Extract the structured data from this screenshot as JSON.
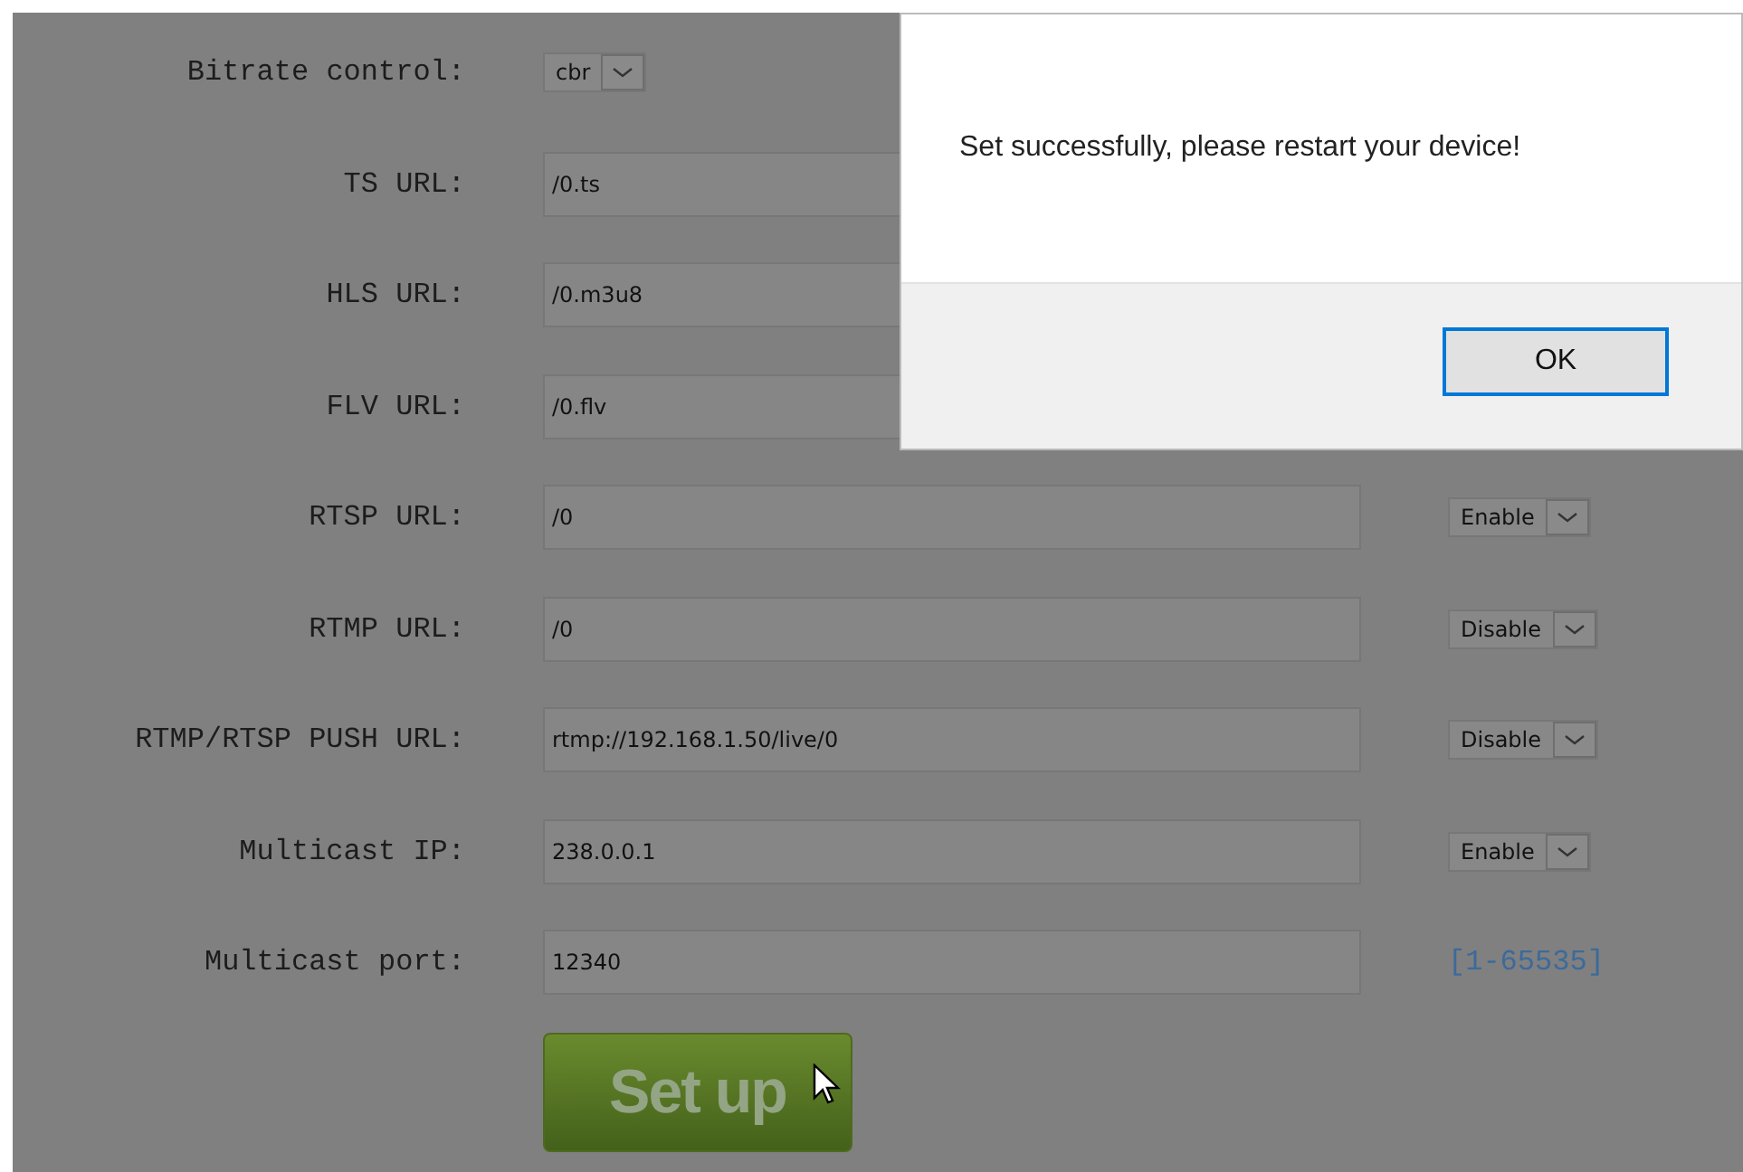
{
  "form": {
    "rows": [
      {
        "kind": "select",
        "label": "Bitrate control:",
        "value": "cbr"
      },
      {
        "kind": "input",
        "label": "TS URL:",
        "value": "/0.ts"
      },
      {
        "kind": "input",
        "label": "HLS URL:",
        "value": "/0.m3u8"
      },
      {
        "kind": "input",
        "label": "FLV URL:",
        "value": "/0.flv"
      },
      {
        "kind": "input",
        "label": "RTSP URL:",
        "value": "/0",
        "toggle": "Enable"
      },
      {
        "kind": "input",
        "label": "RTMP URL:",
        "value": "/0",
        "toggle": "Disable"
      },
      {
        "kind": "input",
        "label": "RTMP/RTSP PUSH URL:",
        "value": "rtmp://192.168.1.50/live/0",
        "toggle": "Disable"
      },
      {
        "kind": "input",
        "label": "Multicast IP:",
        "value": "238.0.0.1",
        "toggle": "Enable"
      },
      {
        "kind": "input",
        "label": "Multicast port:",
        "value": "12340",
        "hint": "[1-65535]"
      }
    ],
    "submit": "Set up"
  },
  "dialog": {
    "message": "Set successfully, please restart your device!",
    "button": "OK"
  }
}
